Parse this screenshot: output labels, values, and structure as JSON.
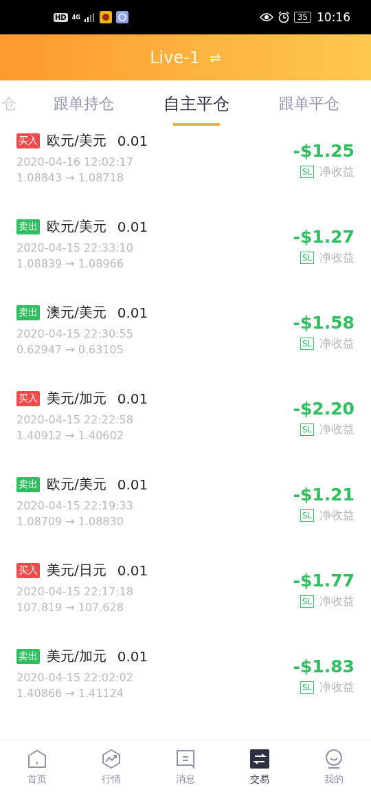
{
  "status_bar": {
    "network_badge": "HD",
    "network_type": "4G",
    "battery": "35",
    "time": "10:16"
  },
  "header": {
    "title": "Live-1",
    "switch_glyph": "⇌"
  },
  "tabs": [
    {
      "label": "仓",
      "selected": false
    },
    {
      "label": "跟单持仓",
      "selected": false
    },
    {
      "label": "自主平仓",
      "selected": true
    },
    {
      "label": "跟单平仓",
      "selected": false
    }
  ],
  "trades": [
    {
      "kind": "buy",
      "side_label": "买入",
      "pair": "欧元/美元",
      "lots": "0.01",
      "time": "2020-04-16 12:02:17",
      "prices": "1.08843 → 1.08718",
      "profit": "-$1.25",
      "sl": "SL",
      "profit_label": "净收益"
    },
    {
      "kind": "sell",
      "side_label": "卖出",
      "pair": "欧元/美元",
      "lots": "0.01",
      "time": "2020-04-15 22:33:10",
      "prices": "1.08839 → 1.08966",
      "profit": "-$1.27",
      "sl": "SL",
      "profit_label": "净收益"
    },
    {
      "kind": "sell",
      "side_label": "卖出",
      "pair": "澳元/美元",
      "lots": "0.01",
      "time": "2020-04-15 22:30:55",
      "prices": "0.62947 → 0.63105",
      "profit": "-$1.58",
      "sl": "SL",
      "profit_label": "净收益"
    },
    {
      "kind": "buy",
      "side_label": "买入",
      "pair": "美元/加元",
      "lots": "0.01",
      "time": "2020-04-15 22:22:58",
      "prices": "1.40912 → 1.40602",
      "profit": "-$2.20",
      "sl": "SL",
      "profit_label": "净收益"
    },
    {
      "kind": "sell",
      "side_label": "卖出",
      "pair": "欧元/美元",
      "lots": "0.01",
      "time": "2020-04-15 22:19:33",
      "prices": "1.08709 → 1.08830",
      "profit": "-$1.21",
      "sl": "SL",
      "profit_label": "净收益"
    },
    {
      "kind": "buy",
      "side_label": "买入",
      "pair": "美元/日元",
      "lots": "0.01",
      "time": "2020-04-15 22:17:18",
      "prices": "107.819 → 107.628",
      "profit": "-$1.77",
      "sl": "SL",
      "profit_label": "净收益"
    },
    {
      "kind": "sell",
      "side_label": "卖出",
      "pair": "美元/加元",
      "lots": "0.01",
      "time": "2020-04-15 22:02:02",
      "prices": "1.40866 → 1.41124",
      "profit": "-$1.83",
      "sl": "SL",
      "profit_label": "净收益"
    }
  ],
  "nav": [
    {
      "label": "首页",
      "selected": false
    },
    {
      "label": "行情",
      "selected": false
    },
    {
      "label": "消息",
      "selected": false
    },
    {
      "label": "交易",
      "selected": true
    },
    {
      "label": "我的",
      "selected": false
    }
  ]
}
